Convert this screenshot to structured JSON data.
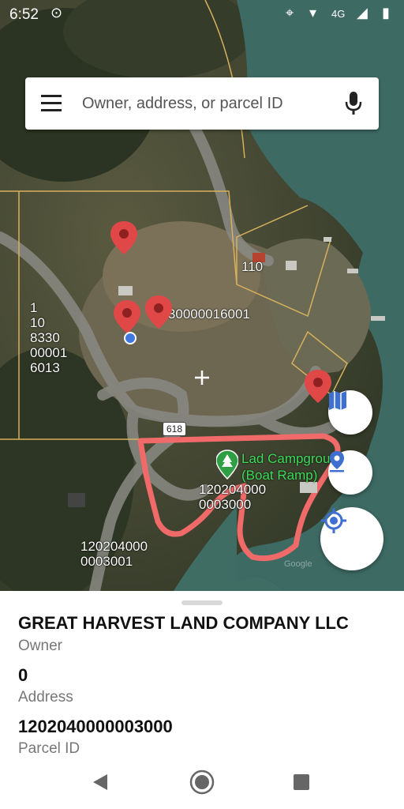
{
  "status_bar": {
    "time": "6:52",
    "network": "4G"
  },
  "search": {
    "placeholder": "Owner, address, or parcel ID"
  },
  "map": {
    "parcel_labels": [
      {
        "id": "p1",
        "text": "110"
      },
      {
        "id": "p2",
        "text": "8330000016001"
      },
      {
        "id": "p3",
        "text": "1\n10\n8330\n00001\n6013"
      },
      {
        "id": "p4",
        "text": "120204000\n0003000"
      },
      {
        "id": "p5",
        "text": "120204000\n0003001"
      }
    ],
    "road_shield": "618",
    "poi_label": "Lad Campground\n(Boat Ramp)",
    "attribution": "Google"
  },
  "sheet": {
    "owner_value": "GREAT HARVEST LAND COMPANY LLC",
    "owner_label": "Owner",
    "address_value": "0",
    "address_label": "Address",
    "parcel_value": "1202040000003000",
    "parcel_label": "Parcel ID"
  },
  "colors": {
    "accent": "#3f6fd1",
    "marker": "#e04848",
    "highlight": "#f06a6a",
    "water": "#3e6a64"
  }
}
